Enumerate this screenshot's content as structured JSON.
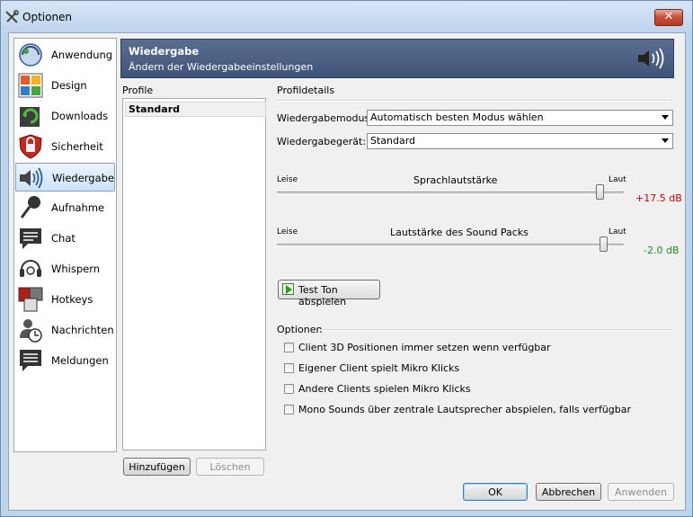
{
  "window": {
    "title": "Optionen",
    "close_glyph": "✕"
  },
  "sidebar": {
    "items": [
      {
        "label": "Anwendung",
        "icon": "application-icon"
      },
      {
        "label": "Design",
        "icon": "design-icon"
      },
      {
        "label": "Downloads",
        "icon": "downloads-icon"
      },
      {
        "label": "Sicherheit",
        "icon": "security-icon"
      },
      {
        "label": "Wiedergabe",
        "icon": "playback-icon",
        "active": true
      },
      {
        "label": "Aufnahme",
        "icon": "microphone-icon"
      },
      {
        "label": "Chat",
        "icon": "chat-icon"
      },
      {
        "label": "Whispern",
        "icon": "headset-icon"
      },
      {
        "label": "Hotkeys",
        "icon": "hotkeys-icon"
      },
      {
        "label": "Nachrichten",
        "icon": "messages-icon"
      },
      {
        "label": "Meldungen",
        "icon": "notifications-icon"
      }
    ]
  },
  "banner": {
    "title": "Wiedergabe",
    "subtitle": "Ändern der Wiedergabeeinstellungen",
    "icon": "speaker-icon"
  },
  "profiles": {
    "label": "Profile",
    "items": [
      "Standard"
    ],
    "add_label": "Hinzufügen",
    "delete_label": "Löschen"
  },
  "details": {
    "label": "Profildetails",
    "mode_label": "Wiedergabemodus:",
    "mode_value": "Automatisch besten Modus wählen",
    "device_label": "Wiedergabegerät:",
    "device_value": "Standard",
    "voice_volume": {
      "low": "Leise",
      "title": "Sprachlautstärke",
      "high": "Laut",
      "value_text": "+17.5 dB",
      "level": 0.93
    },
    "soundpack_volume": {
      "low": "Leise",
      "title": "Lautstärke des Sound Packs",
      "high": "Laut",
      "value_text": "-2.0 dB",
      "level": 0.94
    },
    "test_button": "Test Ton abspielen"
  },
  "options": {
    "label": "Optionen",
    "items": [
      {
        "label": "Client 3D Positionen immer setzen wenn verfügbar",
        "checked": false
      },
      {
        "label": "Eigener Client spielt Mikro Klicks",
        "checked": false
      },
      {
        "label": "Andere Clients spielen Mikro Klicks",
        "checked": false
      },
      {
        "label": "Mono Sounds über zentrale Lautsprecher abspielen, falls verfügbar",
        "checked": false
      }
    ]
  },
  "footer": {
    "ok": "OK",
    "cancel": "Abbrechen",
    "apply": "Anwenden"
  },
  "colors": {
    "banner": "#4b5f82",
    "positive_db": "#cc0000",
    "negative_db": "#209020"
  }
}
